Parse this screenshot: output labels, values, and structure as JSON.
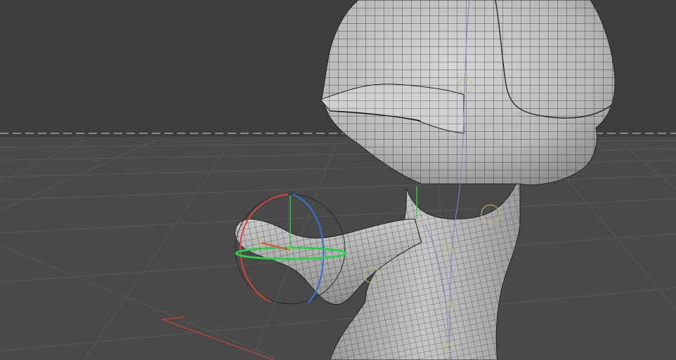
{
  "viewport": {
    "title": "",
    "colors": {
      "sky": "#3e3e3e",
      "ground": "#4a4a4a",
      "grid_line": "#5a5a5a",
      "horizon": "#cfcfcf",
      "mesh_fill": "#bdbdbd",
      "mesh_wire": "#1e1e1e",
      "x_axis": "#d8473f",
      "y_axis": "#2ccf4a",
      "z_axis": "#3a6fd0",
      "joint": "#c9c06a"
    },
    "icons": {
      "rotate_gizmo": "rotate-gizmo-icon",
      "horizon": "horizon-line",
      "grid": "floor-grid"
    }
  }
}
